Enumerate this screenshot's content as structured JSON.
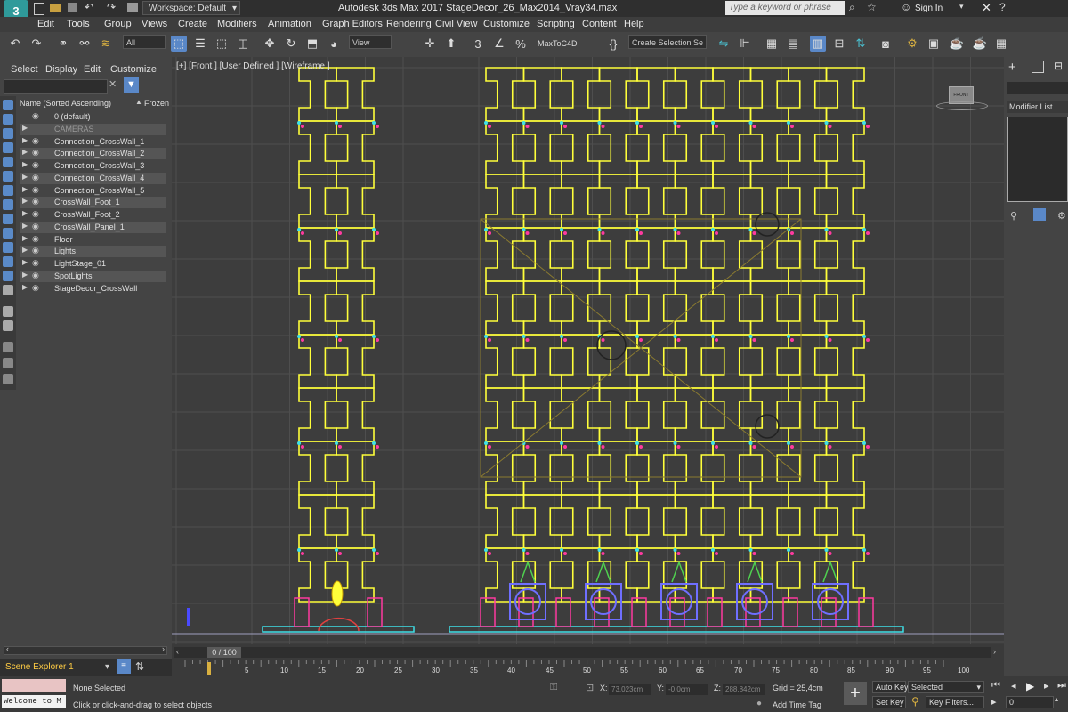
{
  "app": {
    "title": "Autodesk 3ds Max 2017     StageDecor_26_Max2014_Vray34.max",
    "workspace": "Workspace: Default",
    "search_placeholder": "Type a keyword or phrase",
    "sign_in": "Sign In"
  },
  "menu": [
    "Edit",
    "Tools",
    "Group",
    "Views",
    "Create",
    "Modifiers",
    "Animation",
    "Graph Editors",
    "Rendering",
    "Civil View",
    "Customize",
    "Scripting",
    "Content",
    "Help"
  ],
  "toolbar": {
    "selection_filter": "All",
    "reference_coord": "View",
    "maxtoc4d": "MaxToC4D",
    "create_selection_set": "Create Selection Se"
  },
  "scene_explorer": {
    "tabs": [
      "Select",
      "Display",
      "Edit",
      "Customize"
    ],
    "column_name": "Name (Sorted Ascending)",
    "column_frozen": "Frozen",
    "rows": [
      {
        "label": "0 (default)"
      },
      {
        "label": "CAMERAS"
      },
      {
        "label": "Connection_CrossWall_1"
      },
      {
        "label": "Connection_CrossWall_2"
      },
      {
        "label": "Connection_CrossWall_3"
      },
      {
        "label": "Connection_CrossWall_4"
      },
      {
        "label": "Connection_CrossWall_5"
      },
      {
        "label": "CrossWall_Foot_1"
      },
      {
        "label": "CrossWall_Foot_2"
      },
      {
        "label": "CrossWall_Panel_1"
      },
      {
        "label": "Floor"
      },
      {
        "label": "Lights"
      },
      {
        "label": "LightStage_01"
      },
      {
        "label": "SpotLights"
      },
      {
        "label": "StageDecor_CrossWall"
      }
    ],
    "footer": "Scene Explorer 1"
  },
  "viewport": {
    "label": "[+] [Front ] [User Defined ] [Wireframe ]",
    "viewcube": "FRONT"
  },
  "command_panel": {
    "modifier_list": "Modifier List"
  },
  "timeline": {
    "frame_range": "0 / 100",
    "ticks": [
      "5",
      "10",
      "15",
      "20",
      "25",
      "30",
      "35",
      "40",
      "45",
      "50",
      "55",
      "60",
      "65",
      "70",
      "75",
      "80",
      "85",
      "90",
      "95",
      "100"
    ]
  },
  "status": {
    "macro": "Welcome to M",
    "selection": "None Selected",
    "prompt": "Click or click-and-drag to select objects",
    "x_label": "X:",
    "x_value": "73,023cm",
    "y_label": "Y:",
    "y_value": "-0,0cm",
    "z_label": "Z:",
    "z_value": "288,842cm",
    "grid": "Grid = 25,4cm",
    "add_time_tag": "Add Time Tag",
    "auto_key": "Auto Key",
    "set_key": "Set Key",
    "key_mode": "Selected",
    "key_filters": "Key Filters...",
    "frame_value": "0"
  },
  "colors": {
    "wire_yellow": "#ffff3a",
    "wire_cyan": "#3fe0e8",
    "wire_magenta": "#ff3aa0",
    "wire_blue": "#6f6fff",
    "grid": "#4e4e4e"
  }
}
